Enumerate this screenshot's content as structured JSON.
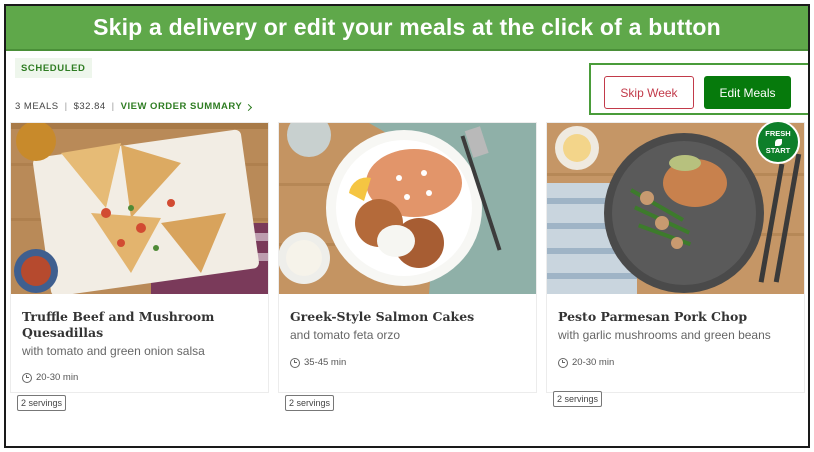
{
  "banner": {
    "text": "Skip a delivery or edit your meals at the click of a button"
  },
  "order": {
    "status": "SCHEDULED",
    "meal_count": "3 MEALS",
    "separator": "|",
    "total": "$32.84",
    "summary_link": "VIEW ORDER SUMMARY"
  },
  "actions": {
    "skip_label": "Skip Week",
    "edit_label": "Edit Meals"
  },
  "colors": {
    "brand_green": "#067a0c",
    "banner_green": "#5fa84a",
    "skip_red": "#c23a4a"
  },
  "meals": [
    {
      "title": "Truffle Beef and Mushroom Quesadillas",
      "subtitle": "with tomato and green onion salsa",
      "time": "20-30 min",
      "servings": "2 servings"
    },
    {
      "title": "Greek-Style Salmon Cakes",
      "subtitle": "and tomato feta orzo",
      "time": "35-45 min",
      "servings": "2 servings"
    },
    {
      "title": "Pesto Parmesan Pork Chop",
      "subtitle": "with garlic mushrooms and green beans",
      "time": "20-30 min",
      "servings": "2 servings",
      "badge": {
        "line1": "FRESH",
        "line2": "START",
        "icon": "leaf-icon"
      }
    }
  ]
}
